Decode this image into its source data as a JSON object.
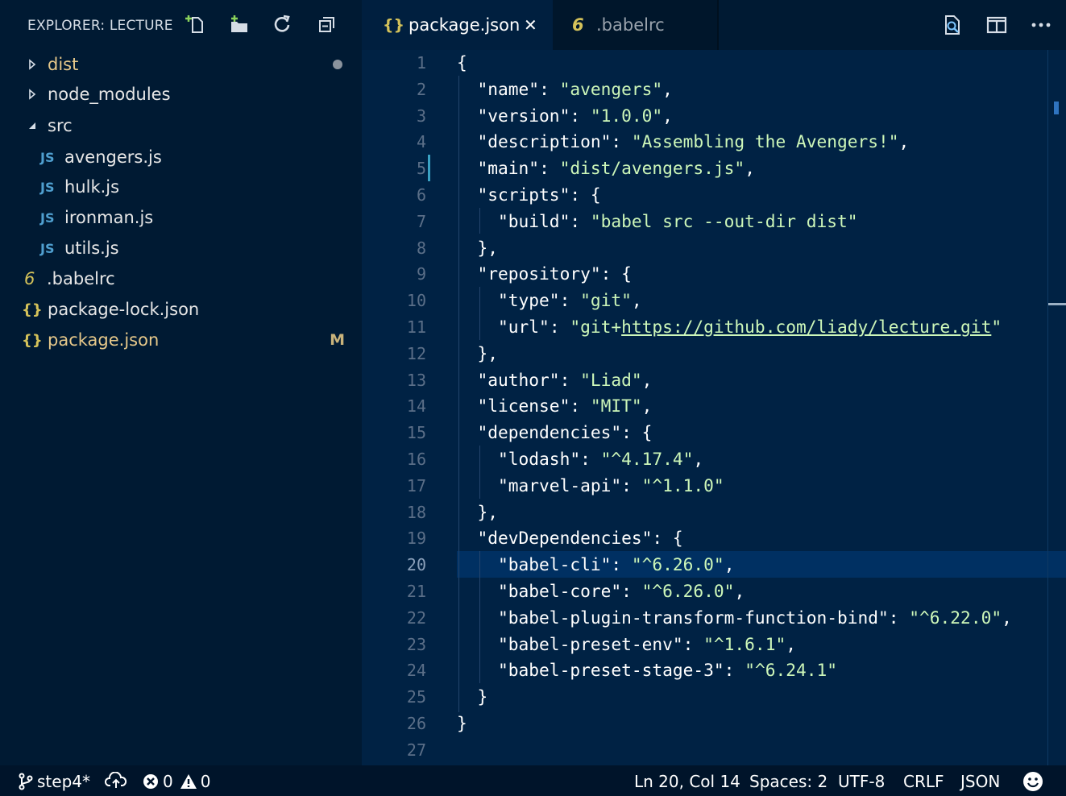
{
  "sidebar": {
    "title": "EXPLORER: LECTURE",
    "icons": [
      "new-file-icon",
      "new-folder-icon",
      "refresh-icon",
      "collapse-all-icon"
    ],
    "items": [
      {
        "label": "dist",
        "type": "folder",
        "expanded": false,
        "depth": 0,
        "color": "#e6c88a"
      },
      {
        "label": "node_modules",
        "type": "folder",
        "expanded": false,
        "depth": 0,
        "color": "#e6e6e6"
      },
      {
        "label": "src",
        "type": "folder",
        "expanded": true,
        "depth": 0,
        "color": "#e6e6e6"
      },
      {
        "label": "avengers.js",
        "type": "file",
        "icon_text": "JS",
        "depth": 1,
        "color": "#e6e6e6"
      },
      {
        "label": "hulk.js",
        "type": "file",
        "icon_text": "JS",
        "depth": 1,
        "color": "#e6e6e6"
      },
      {
        "label": "ironman.js",
        "type": "file",
        "icon_text": "JS",
        "depth": 1,
        "color": "#e6e6e6"
      },
      {
        "label": "utils.js",
        "type": "file",
        "icon_text": "JS",
        "depth": 1,
        "color": "#e6e6e6"
      },
      {
        "label": ".babelrc",
        "type": "file",
        "icon_text": "6",
        "depth": 0,
        "color": "#e6e6e6"
      },
      {
        "label": "package-lock.json",
        "type": "file",
        "icon_text": "{}",
        "depth": 0,
        "color": "#e6e6e6"
      },
      {
        "label": "package.json",
        "type": "file",
        "icon_text": "{}",
        "depth": 0,
        "color": "#e6c88a",
        "badge": "M"
      }
    ]
  },
  "tabs": [
    {
      "label": "package.json",
      "icon_text": "{}",
      "active": true,
      "close": "✕"
    },
    {
      "label": ".babelrc",
      "icon_text": "6",
      "active": false
    }
  ],
  "editor_actions": [
    "open-preview-icon",
    "split-editor-icon",
    "more-actions-icon"
  ],
  "code": {
    "current_line": 20,
    "lines": [
      [
        [
          "p",
          "{"
        ]
      ],
      [
        [
          "p",
          "  "
        ],
        [
          "k",
          "\"name\""
        ],
        [
          "p",
          ": "
        ],
        [
          "s",
          "\"avengers\""
        ],
        [
          "p",
          ","
        ]
      ],
      [
        [
          "p",
          "  "
        ],
        [
          "k",
          "\"version\""
        ],
        [
          "p",
          ": "
        ],
        [
          "s",
          "\"1.0.0\""
        ],
        [
          "p",
          ","
        ]
      ],
      [
        [
          "p",
          "  "
        ],
        [
          "k",
          "\"description\""
        ],
        [
          "p",
          ": "
        ],
        [
          "s",
          "\"Assembling the Avengers!\""
        ],
        [
          "p",
          ","
        ]
      ],
      [
        [
          "p",
          "  "
        ],
        [
          "k",
          "\"main\""
        ],
        [
          "p",
          ": "
        ],
        [
          "s",
          "\"dist/avengers.js\""
        ],
        [
          "p",
          ","
        ]
      ],
      [
        [
          "p",
          "  "
        ],
        [
          "k",
          "\"scripts\""
        ],
        [
          "p",
          ": {"
        ]
      ],
      [
        [
          "p",
          "    "
        ],
        [
          "k",
          "\"build\""
        ],
        [
          "p",
          ": "
        ],
        [
          "s",
          "\"babel src --out-dir dist\""
        ]
      ],
      [
        [
          "p",
          "  },"
        ]
      ],
      [
        [
          "p",
          "  "
        ],
        [
          "k",
          "\"repository\""
        ],
        [
          "p",
          ": {"
        ]
      ],
      [
        [
          "p",
          "    "
        ],
        [
          "k",
          "\"type\""
        ],
        [
          "p",
          ": "
        ],
        [
          "s",
          "\"git\""
        ],
        [
          "p",
          ","
        ]
      ],
      [
        [
          "p",
          "    "
        ],
        [
          "k",
          "\"url\""
        ],
        [
          "p",
          ": "
        ],
        [
          "s",
          "\"git+"
        ],
        [
          "u",
          "https://github.com/liady/lecture.git"
        ],
        [
          "s",
          "\""
        ]
      ],
      [
        [
          "p",
          "  },"
        ]
      ],
      [
        [
          "p",
          "  "
        ],
        [
          "k",
          "\"author\""
        ],
        [
          "p",
          ": "
        ],
        [
          "s",
          "\"Liad\""
        ],
        [
          "p",
          ","
        ]
      ],
      [
        [
          "p",
          "  "
        ],
        [
          "k",
          "\"license\""
        ],
        [
          "p",
          ": "
        ],
        [
          "s",
          "\"MIT\""
        ],
        [
          "p",
          ","
        ]
      ],
      [
        [
          "p",
          "  "
        ],
        [
          "k",
          "\"dependencies\""
        ],
        [
          "p",
          ": {"
        ]
      ],
      [
        [
          "p",
          "    "
        ],
        [
          "k",
          "\"lodash\""
        ],
        [
          "p",
          ": "
        ],
        [
          "s",
          "\"^4.17.4\""
        ],
        [
          "p",
          ","
        ]
      ],
      [
        [
          "p",
          "    "
        ],
        [
          "k",
          "\"marvel-api\""
        ],
        [
          "p",
          ": "
        ],
        [
          "s",
          "\"^1.1.0\""
        ]
      ],
      [
        [
          "p",
          "  },"
        ]
      ],
      [
        [
          "p",
          "  "
        ],
        [
          "k",
          "\"devDependencies\""
        ],
        [
          "p",
          ": {"
        ]
      ],
      [
        [
          "p",
          "    "
        ],
        [
          "k",
          "\"babel-cli\""
        ],
        [
          "p",
          ": "
        ],
        [
          "s",
          "\"^6.26.0\""
        ],
        [
          "p",
          ","
        ]
      ],
      [
        [
          "p",
          "    "
        ],
        [
          "k",
          "\"babel-core\""
        ],
        [
          "p",
          ": "
        ],
        [
          "s",
          "\"^6.26.0\""
        ],
        [
          "p",
          ","
        ]
      ],
      [
        [
          "p",
          "    "
        ],
        [
          "k",
          "\"babel-plugin-transform-function-bind\""
        ],
        [
          "p",
          ": "
        ],
        [
          "s",
          "\"^6.22.0\""
        ],
        [
          "p",
          ","
        ]
      ],
      [
        [
          "p",
          "    "
        ],
        [
          "k",
          "\"babel-preset-env\""
        ],
        [
          "p",
          ": "
        ],
        [
          "s",
          "\"^1.6.1\""
        ],
        [
          "p",
          ","
        ]
      ],
      [
        [
          "p",
          "    "
        ],
        [
          "k",
          "\"babel-preset-stage-3\""
        ],
        [
          "p",
          ": "
        ],
        [
          "s",
          "\"^6.24.1\""
        ]
      ],
      [
        [
          "p",
          "  }"
        ]
      ],
      [
        [
          "p",
          "}"
        ]
      ],
      [
        [
          "p",
          ""
        ]
      ]
    ]
  },
  "statusbar": {
    "branch": "step4*",
    "errors": "0",
    "warnings": "0",
    "position": "Ln 20, Col 14",
    "spaces": "Spaces: 2",
    "encoding": "UTF-8",
    "eol": "CRLF",
    "language": "JSON"
  },
  "colors": {
    "js_icon": "#4f9fcf",
    "json_icon": "#d4c25a",
    "babel_icon": "#d4c25a",
    "string": "#cdf7b9",
    "key": "#ffffff"
  }
}
